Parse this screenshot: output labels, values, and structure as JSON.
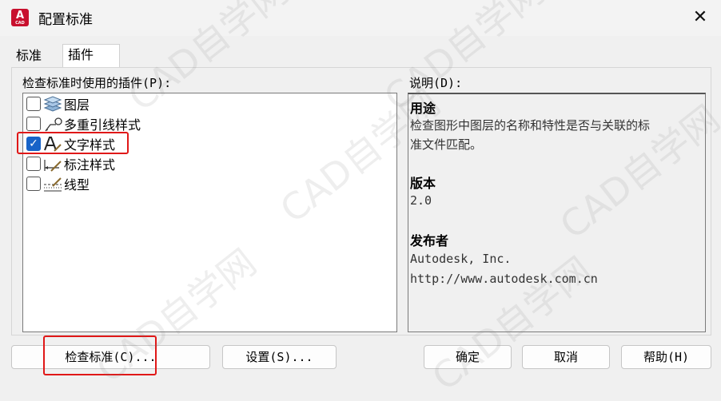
{
  "window": {
    "title": "配置标准",
    "icon_label": "A",
    "icon_sub": "CAD"
  },
  "tabs": [
    {
      "label": "标准"
    },
    {
      "label": "插件"
    }
  ],
  "plugins_label": "检查标准时使用的插件(P):",
  "plugins": [
    {
      "label": "图层",
      "checked": false,
      "icon": "layers-icon"
    },
    {
      "label": "多重引线样式",
      "checked": false,
      "icon": "multileader-icon"
    },
    {
      "label": "文字样式",
      "checked": true,
      "icon": "text-style-icon"
    },
    {
      "label": "标注样式",
      "checked": false,
      "icon": "dimension-style-icon"
    },
    {
      "label": "线型",
      "checked": false,
      "icon": "linetype-icon"
    }
  ],
  "description_label": "说明(D):",
  "description": {
    "purpose_heading": "用途",
    "purpose_line1": "检查图形中图层的名称和特性是否与关联的标",
    "purpose_line2": "准文件匹配。",
    "version_heading": "版本",
    "version": "2.0",
    "publisher_heading": "发布者",
    "publisher_name": "Autodesk, Inc.",
    "publisher_url": "http://www.autodesk.com.cn"
  },
  "buttons": {
    "check": "检查标准(C)...",
    "settings": "设置(S)...",
    "ok": "确定",
    "cancel": "取消",
    "help": "帮助(H)"
  },
  "watermark": "CAD自学网",
  "highlight_color": "#e01818",
  "checkbox_color": "#1763c8",
  "close_glyph": "✕",
  "check_glyph": "✓"
}
